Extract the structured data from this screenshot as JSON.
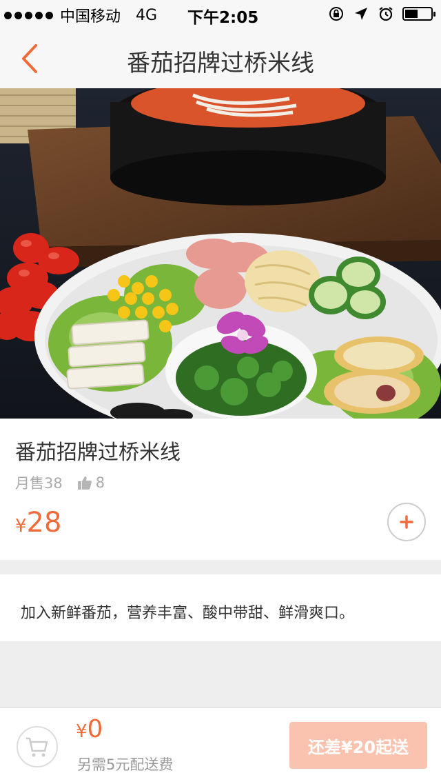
{
  "status_bar": {
    "carrier": "中国移动",
    "network": "4G",
    "time": "下午2:05"
  },
  "nav": {
    "title": "番茄招牌过桥米线",
    "back_icon": "chevron-left-icon"
  },
  "product": {
    "name": "番茄招牌过桥米线",
    "monthly_sales": "月售38",
    "likes": "8",
    "price_currency": "¥",
    "price": "28",
    "add_icon": "plus-icon"
  },
  "description": {
    "text": "加入新鲜番茄，营养丰富、酸中带甜、鲜滑爽口。"
  },
  "cart": {
    "currency": "¥",
    "total": "0",
    "delivery_note": "另需5元配送费",
    "checkout_label": "还差¥20起送"
  },
  "colors": {
    "accent": "#f06a3a",
    "checkout_disabled": "#f9c3b0"
  }
}
